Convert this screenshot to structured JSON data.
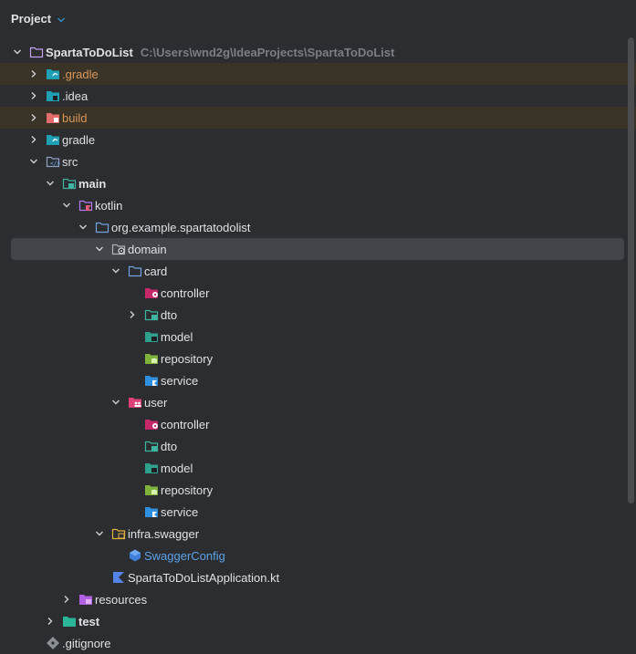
{
  "panel": {
    "title": "Project"
  },
  "tree": [
    {
      "label": "SpartaToDoList",
      "path": "C:\\Users\\wnd2g\\IdeaProjects\\SpartaToDoList",
      "level": 0,
      "expanded": true,
      "icon": "module-folder-icon",
      "bold": true
    },
    {
      "label": ".gradle",
      "level": 1,
      "expanded": false,
      "icon": "gradle-folder-icon",
      "color": "orange",
      "hl": true
    },
    {
      "label": ".idea",
      "level": 1,
      "expanded": false,
      "icon": "idea-folder-icon"
    },
    {
      "label": "build",
      "level": 1,
      "expanded": false,
      "icon": "build-folder-icon",
      "color": "orange",
      "hl": true
    },
    {
      "label": "gradle",
      "level": 1,
      "expanded": false,
      "icon": "gradle-folder-icon"
    },
    {
      "label": "src",
      "level": 1,
      "expanded": true,
      "icon": "src-folder-icon"
    },
    {
      "label": "main",
      "level": 2,
      "expanded": true,
      "icon": "source-root-folder-icon",
      "bold": true
    },
    {
      "label": "kotlin",
      "level": 3,
      "expanded": true,
      "icon": "kotlin-folder-icon"
    },
    {
      "label": "org.example.spartatodolist",
      "level": 4,
      "expanded": true,
      "icon": "package-folder-icon"
    },
    {
      "label": "domain",
      "level": 5,
      "expanded": true,
      "icon": "domain-folder-icon",
      "selected": true
    },
    {
      "label": "card",
      "level": 6,
      "expanded": true,
      "icon": "package-folder-icon"
    },
    {
      "label": "controller",
      "level": 7,
      "icon": "controller-folder-icon"
    },
    {
      "label": "dto",
      "level": 7,
      "expanded": false,
      "icon": "dto-folder-icon"
    },
    {
      "label": "model",
      "level": 7,
      "icon": "model-folder-icon"
    },
    {
      "label": "repository",
      "level": 7,
      "icon": "repository-folder-icon"
    },
    {
      "label": "service",
      "level": 7,
      "icon": "service-folder-icon"
    },
    {
      "label": "user",
      "level": 6,
      "expanded": true,
      "icon": "user-folder-icon"
    },
    {
      "label": "controller",
      "level": 7,
      "icon": "controller-folder-icon"
    },
    {
      "label": "dto",
      "level": 7,
      "icon": "dto-folder-icon"
    },
    {
      "label": "model",
      "level": 7,
      "icon": "model-folder-icon"
    },
    {
      "label": "repository",
      "level": 7,
      "icon": "repository-folder-icon"
    },
    {
      "label": "service",
      "level": 7,
      "icon": "service-folder-icon"
    },
    {
      "label": "infra.swagger",
      "level": 5,
      "expanded": true,
      "icon": "infra-folder-icon"
    },
    {
      "label": "SwaggerConfig",
      "level": 6,
      "icon": "kotlin-class-icon",
      "color": "blue"
    },
    {
      "label": "SpartaToDoListApplication.kt",
      "level": 5,
      "icon": "kotlin-file-icon"
    },
    {
      "label": "resources",
      "level": 3,
      "expanded": false,
      "icon": "resources-folder-icon"
    },
    {
      "label": "test",
      "level": 2,
      "expanded": false,
      "icon": "test-folder-icon",
      "bold": true
    },
    {
      "label": ".gitignore",
      "level": 1,
      "icon": "git-file-icon"
    }
  ],
  "colors": {
    "background": "#2b2d30",
    "text": "#dfe1e5",
    "excluded": "#d9975a",
    "class": "#5ca1e6",
    "selected": "#43454a"
  }
}
